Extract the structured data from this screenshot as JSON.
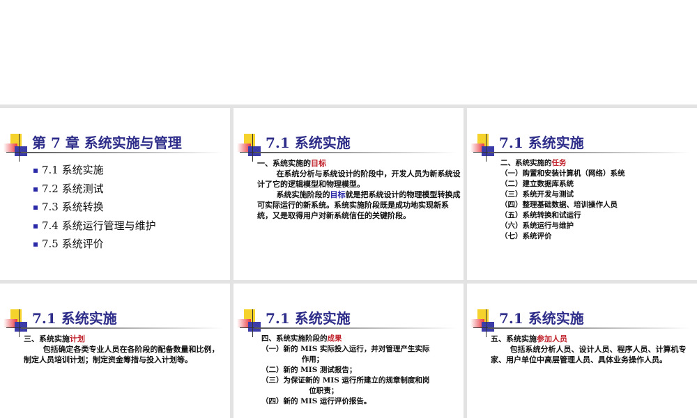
{
  "slides": [
    {
      "title": "第 7 章  系统实施与管理",
      "items": [
        "7.1 系统实施",
        "7.2  系统测试",
        "7.3  系统转换",
        "7.4  系统运行管理与维护",
        "7.5  系统评价"
      ]
    },
    {
      "title": "7.1  系统实施",
      "heading": "一、系统实施的",
      "heading_hl": "目标",
      "p1": "在系统分析与系统设计的阶段中，开发人员为新系统设计了它的逻辑模型和物理模型。",
      "p2a": "系统实施阶段的",
      "p2hl": "目标",
      "p2b": "就是把系统设计的物理模型转换成可实际运行的新系统。系统实施阶段既是成功地实现新系统，又是取得用户对新系统信任的关键阶段。"
    },
    {
      "title": "7.1  系统实施",
      "heading": "二、系统实施的",
      "heading_hl": "任务",
      "items": [
        "（一）购置和安装计算机（网络）系统",
        "（二）建立数据库系统",
        "（三）系统开发与测试",
        "（四）整理基础数据、培训操作人员",
        "（五）系统转换和试运行",
        "（六）系统运行与维护",
        "（七）系统评价"
      ]
    },
    {
      "title": "7.1  系统实施",
      "heading": "三、系统实施",
      "heading_hl": "计划",
      "p1": "包括确定各类专业人员在各阶段的配备数量和比例，制定人员培训计划；制定资金筹措与投入计划等。"
    },
    {
      "title": "7.1  系统实施",
      "heading": "四、系统实施阶段的",
      "heading_hl": "成果",
      "items": [
        "（一）新的 MIS 实际投入运行，并对管理产生实际",
        "作用；",
        "（二）新的 MIS 测试报告；",
        "（三）为保证新的 MIS 运行所建立的规章制度和岗",
        "位职责；",
        "（四）新的 MIS 运行评价报告。"
      ]
    },
    {
      "title": "7.1  系统实施",
      "heading": "五、系统实施",
      "heading_hl": "参加人员",
      "p1": "包括系统分析人员、设计人员、程序人员、计算机专家、用户单位中高层管理人员、具体业务操作人员。"
    }
  ]
}
